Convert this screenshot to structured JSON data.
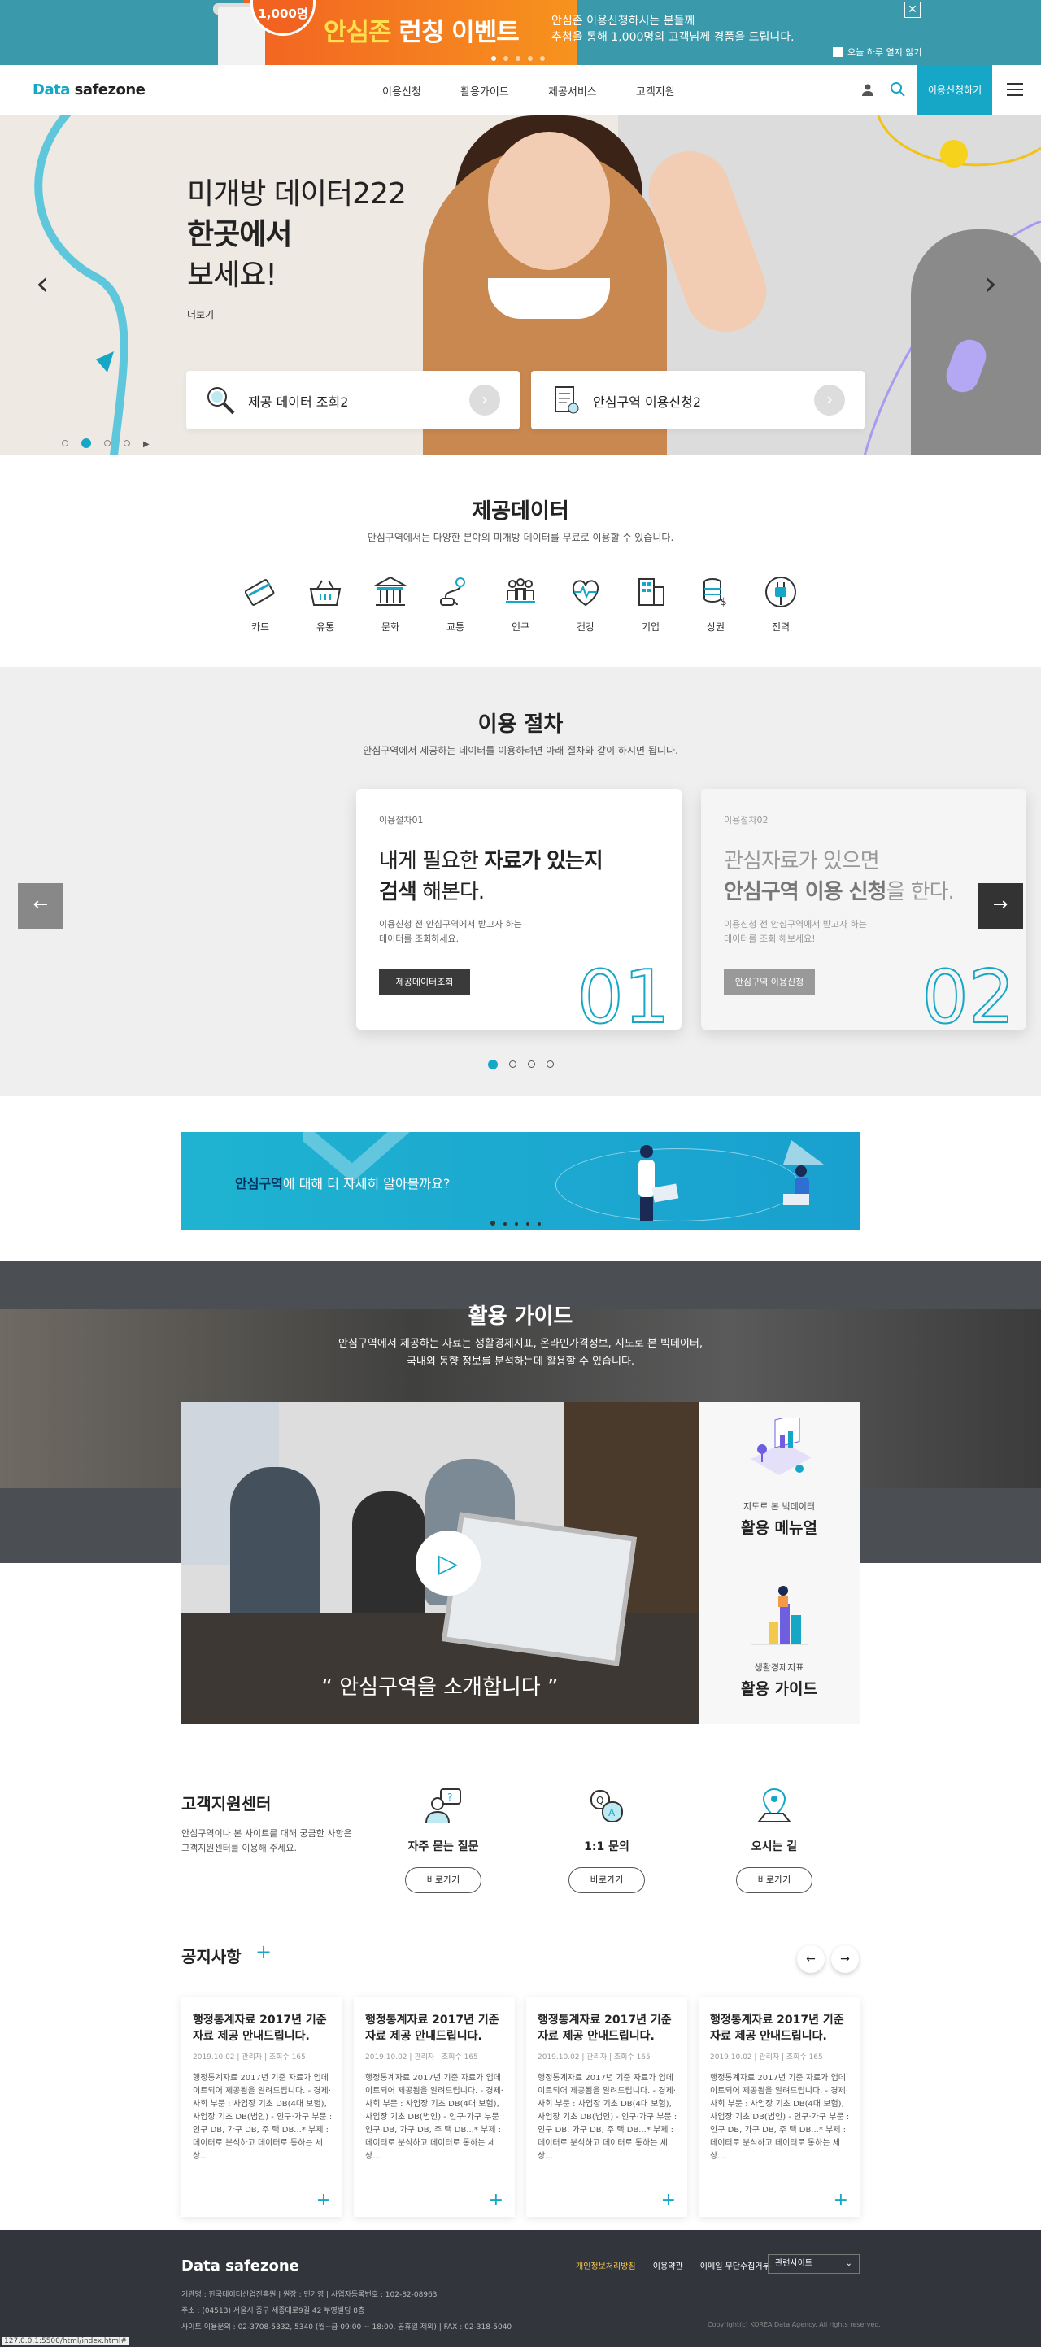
{
  "topbanner": {
    "badge": "1,000명",
    "title_bold": "안심존",
    "title_rest": " 런칭 이벤트",
    "desc1": "안심존 이용신청하시는 분들께",
    "desc2": "추첨을 통해 1,000명의 고객님께 경품을 드립니다.",
    "check_label": "오늘 하루 열지 않기",
    "close_label": "✕"
  },
  "header": {
    "logo_a": "Data ",
    "logo_b": "safezone",
    "nav": [
      "이용신청",
      "활용가이드",
      "제공서비스",
      "고객지원"
    ],
    "apply_label": "이용신청하기"
  },
  "hero": {
    "line1": "미개방 데이터222",
    "line2": "한곳에서",
    "line3": "보세요!",
    "more": "더보기",
    "card1": "제공 데이터 조회2",
    "card2": "안심구역 이용신청2"
  },
  "provide": {
    "title": "제공데이터",
    "desc": "안심구역에서는 다양한 분야의 미개방 데이터를 무료로 이용할 수 있습니다.",
    "items": [
      "카드",
      "유통",
      "문화",
      "교통",
      "인구",
      "건강",
      "기업",
      "상권",
      "전력"
    ]
  },
  "procedure": {
    "title": "이용 절차",
    "desc": "안심구역에서 제공하는 데이터를 이용하려면 아래 절차와 같이 하시면 됩니다.",
    "steps": [
      {
        "step": "이용절차01",
        "t1": "내게 필요한 ",
        "t1b": "자료가 있는지",
        "t2b": "검색",
        "t2": " 해본다.",
        "d1": "이용신청 전 안심구역에서 받고자 하는",
        "d2": "데이터를 조회하세요.",
        "btn": "제공데이터조회",
        "num": "01"
      },
      {
        "step": "이용절차02",
        "t1": "관심자료가 있으면",
        "t1b": "",
        "t2b": "안심구역 이용 신청",
        "t2": "을 한다.",
        "d1": "이용신청 전 안심구역에서 받고자 하는",
        "d2": "데이터를 조회 해보세요!",
        "btn": "안심구역 이용신청",
        "num": "02"
      }
    ],
    "prev": "←",
    "next": "→"
  },
  "promo": {
    "text_bold": "안심구역",
    "text_rest": "에 대해 더 자세히 알아볼까요?"
  },
  "guide": {
    "title": "활용 가이드",
    "desc1": "안심구역에서 제공하는 자료는 생활경제지표, 온라인가격정보, 지도로 본 빅데이터,",
    "desc2": "국내외 동향 정보를 분석하는데 활용할 수 있습니다.",
    "video_caption": "“ 안심구역을 소개합니다 ”",
    "box1_sub": "지도로 본 빅데이터",
    "box1_title": "활용 메뉴얼",
    "box2_sub": "생활경제지표",
    "box2_title": "활용 가이드"
  },
  "support": {
    "title": "고객지원센터",
    "desc1": "안심구역이나 본 사이트를 대해 궁금한 사항은",
    "desc2": "고객지원센터를 이용해 주세요.",
    "items": [
      {
        "label": "자주 묻는 질문",
        "btn": "바로가기"
      },
      {
        "label": "1:1 문의",
        "btn": "바로가기"
      },
      {
        "label": "오시는 길",
        "btn": "바로가기"
      }
    ]
  },
  "notice": {
    "title": "공지사항",
    "plus": "+",
    "items": [
      {
        "title": "행정통계자료 2017년 기준 자료 제공 안내드립니다.",
        "meta": "2019.10.02 | 관리자 | 조회수 165",
        "desc": "행정통계자료 2017년 기준 자료가 업데이트되어 제공됨을 알려드립니다. - 경제·사회 부문 : 사업장 기초 DB(4대 보험), 사업장 기초 DB(법인) - 인구·가구 부문 : 인구 DB, 가구 DB, 주 택 DB...* 부제 : 데이터로 분석하고 데이터로 통하는 세상..."
      },
      {
        "title": "행정통계자료 2017년 기준 자료 제공 안내드립니다.",
        "meta": "2019.10.02 | 관리자 | 조회수 165",
        "desc": "행정통계자료 2017년 기준 자료가 업데이트되어 제공됨을 알려드립니다. - 경제·사회 부문 : 사업장 기초 DB(4대 보험), 사업장 기초 DB(법인) - 인구·가구 부문 : 인구 DB, 가구 DB, 주 택 DB...* 부제 : 데이터로 분석하고 데이터로 통하는 세상..."
      },
      {
        "title": "행정통계자료 2017년 기준 자료 제공 안내드립니다.",
        "meta": "2019.10.02 | 관리자 | 조회수 165",
        "desc": "행정통계자료 2017년 기준 자료가 업데이트되어 제공됨을 알려드립니다. - 경제·사회 부문 : 사업장 기초 DB(4대 보험), 사업장 기초 DB(법인) - 인구·가구 부문 : 인구 DB, 가구 DB, 주 택 DB...* 부제 : 데이터로 분석하고 데이터로 통하는 세상..."
      },
      {
        "title": "행정통계자료 2017년 기준 자료 제공 안내드립니다.",
        "meta": "2019.10.02 | 관리자 | 조회수 165",
        "desc": "행정통계자료 2017년 기준 자료가 업데이트되어 제공됨을 알려드립니다. - 경제·사회 부문 : 사업장 기초 DB(4대 보험), 사업장 기초 DB(법인) - 인구·가구 부문 : 인구 DB, 가구 DB, 주 택 DB...* 부제 : 데이터로 분석하고 데이터로 통하는 세상..."
      }
    ]
  },
  "footer": {
    "logo": "Data safezone",
    "links": [
      "개인정보처리방침",
      "이용약관",
      "이메일 무단수집거부"
    ],
    "select": "관련사이트",
    "info1": "기관명 : 한국데이터산업진흥원  |  원장 : 민기영  |  사업자등록번호 : 102-82-08963",
    "info2": "주소 : (04513) 서울시 중구 세종대로9길 42 부영빌딩 8층",
    "info3": "사이트 이용문의 : 02-3708-5332, 5340 (월~금 09:00 ~ 18:00, 공휴일 제외)  |  FAX : 02-318-5040",
    "copyright": "Copyright(c) KOREA Data Agency. All rights reserved."
  },
  "statusbar": "127.0.0.1:5500/html/index.html#"
}
